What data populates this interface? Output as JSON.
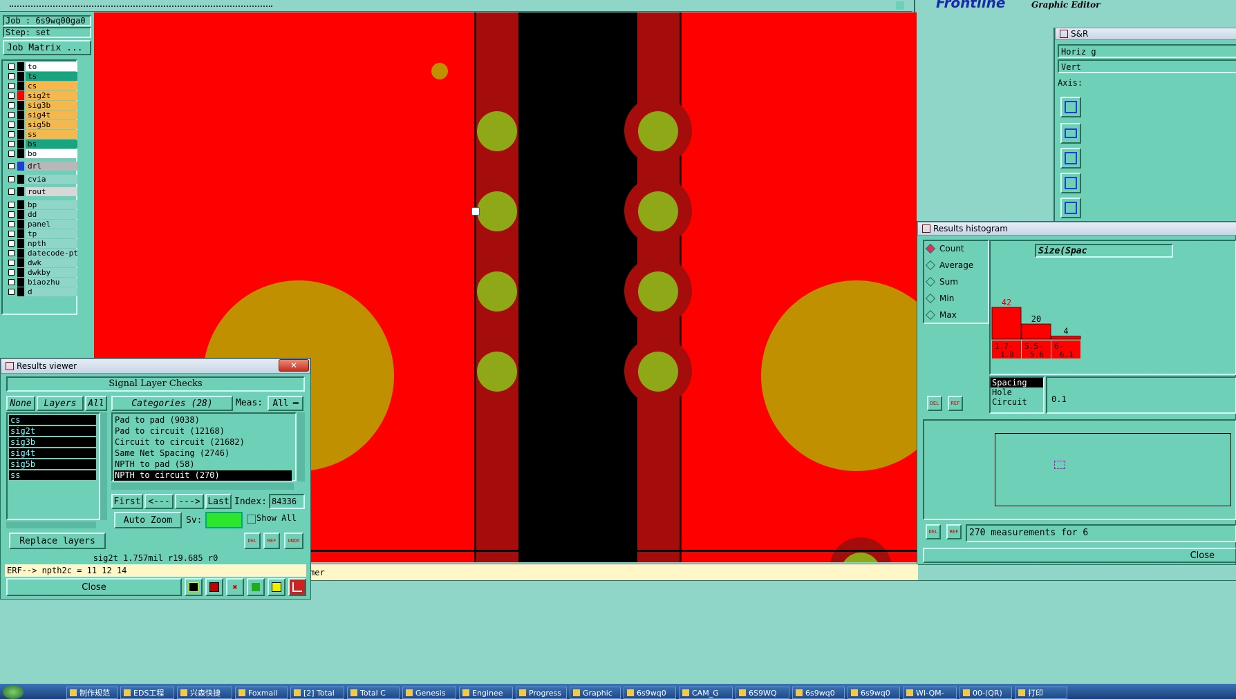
{
  "top": {
    "brand": "Frontline",
    "editor_title": "Graphic Editor"
  },
  "left_panel": {
    "job": "Job : 6s9wq00ga0",
    "step": "Step: set",
    "job_matrix": "Job Matrix ..."
  },
  "layers": [
    {
      "name": "to",
      "color": "#ffffff"
    },
    {
      "name": "ts",
      "color": "#19a37e"
    },
    {
      "name": "cs",
      "color": "#f6b84c"
    },
    {
      "name": "sig2t",
      "color": "#f6b84c"
    },
    {
      "name": "sig3b",
      "color": "#f6b84c"
    },
    {
      "name": "sig4t",
      "color": "#f6b84c"
    },
    {
      "name": "sig5b",
      "color": "#f6b84c"
    },
    {
      "name": "ss",
      "color": "#f6b84c"
    },
    {
      "name": "bs",
      "color": "#19a37e"
    },
    {
      "name": "bo",
      "color": "#ffffff"
    },
    {
      "name": "drl",
      "color": "#b8b8b8"
    },
    {
      "name": "cvia",
      "color": "#8fd6c8"
    },
    {
      "name": "rout",
      "color": "#d8d8d8"
    },
    {
      "name": "bp",
      "color": "#8fd6c8"
    },
    {
      "name": "dd",
      "color": "#8fd6c8"
    },
    {
      "name": "panel",
      "color": "#8fd6c8"
    },
    {
      "name": "tp",
      "color": "#8fd6c8"
    },
    {
      "name": "npth",
      "color": "#8fd6c8"
    },
    {
      "name": "datecode-pt",
      "color": "#8fd6c8"
    },
    {
      "name": "dwk",
      "color": "#8fd6c8"
    },
    {
      "name": "dwkby",
      "color": "#8fd6c8"
    },
    {
      "name": "biaozhu",
      "color": "#8fd6c8"
    },
    {
      "name": "d",
      "color": "#8fd6c8"
    }
  ],
  "sr_panel": {
    "title": "S&R",
    "horiz": "Horiz g",
    "vert": "Vert",
    "axis": "Axis:"
  },
  "results_viewer": {
    "title": "Results viewer",
    "header": "Signal Layer Checks",
    "none_btn": "None",
    "layers_label": "Layers",
    "all_btn": "All",
    "layer_list": [
      "cs",
      "sig2t",
      "sig3b",
      "sig4t",
      "sig5b",
      "ss"
    ],
    "categories_label": "Categories (28)",
    "meas_label": "Meas:",
    "meas_value": "All",
    "categories": [
      "Pad to pad (9038)",
      "Pad to circuit (12168)",
      "Circuit to circuit (21682)",
      "Same Net Spacing (2746)",
      "NPTH to pad (58)",
      "NPTH to circuit (270)"
    ],
    "selected_category_index": 5,
    "first_btn": "First",
    "prev_btn": "<---",
    "next_btn": "--->",
    "last_btn": "Last",
    "index_label": "Index:",
    "index_value": "84336",
    "auto_zoom": "Auto Zoom",
    "sv_label": "Sv:",
    "show_all": "Show All",
    "replace_layers": "Replace layers",
    "del": "DEL",
    "ref": "REF",
    "undo": "UNDO",
    "status": "sig2t 1.757mil   r19.685  r0",
    "erf": "ERF--> npth2c = 11 12 14",
    "close": "Close"
  },
  "histogram": {
    "title": "Results histogram",
    "modes": [
      "Count",
      "Average",
      "Sum",
      "Min",
      "Max"
    ],
    "selected_mode": "Count",
    "size_label": "Size(Spac",
    "chart_data": {
      "type": "bar",
      "categories": [
        "1.7-1.8",
        "5.5-5.6",
        "6-6.1"
      ],
      "values": [
        42,
        20,
        4
      ]
    },
    "types": [
      "Spacing",
      "Hole",
      "Circuit"
    ],
    "value_field": "0.1",
    "measurements": "270 measurements for 6",
    "close": "Close",
    "del": "DEL",
    "ref": "REF"
  },
  "message_bar": "mer",
  "taskbar": [
    "制作规范",
    "EDS工程",
    "兴森快捷",
    "Foxmail",
    "[2] Total",
    "Total C",
    "Genesis",
    "Enginee",
    "Progress",
    "Graphic",
    "6s9wq0",
    "CAM_G",
    "6S9WQ",
    "6s9wq0",
    "6s9wq0",
    "WI-QM-",
    "00-(QR)",
    "打印"
  ],
  "colors": {
    "copper": "#ff0000",
    "hatched": "#a50c0c",
    "pad": "#8ea818",
    "large_pad": "#c09000",
    "background": "#000000",
    "panel": "#6fd0b8"
  }
}
